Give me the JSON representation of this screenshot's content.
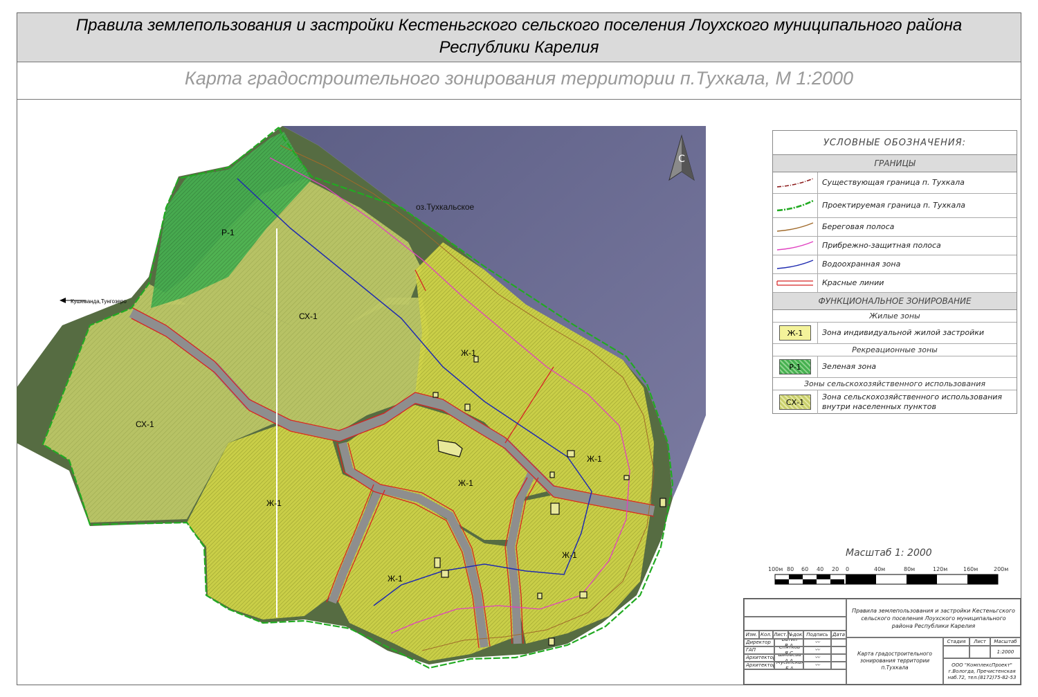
{
  "header": {
    "title_line1": "Правила землепользования и застройки Кестеньгского сельского поселения Лоухского муниципального района",
    "title_line2": "Республики Карелия",
    "map_title": "Карта градостроительного зонирования территории п.Тухкала,  М 1:2000"
  },
  "map": {
    "north_letter": "С",
    "lake_label": "оз.Тухкальское",
    "road_direction_label": "Кушеванда,Тунгозеро",
    "zone_labels": [
      {
        "id": "r1",
        "text": "Р-1"
      },
      {
        "id": "sx1a",
        "text": "СХ-1"
      },
      {
        "id": "sx1b",
        "text": "СХ-1"
      },
      {
        "id": "zh1a",
        "text": "Ж-1"
      },
      {
        "id": "zh1b",
        "text": "Ж-1"
      },
      {
        "id": "zh1c",
        "text": "Ж-1"
      },
      {
        "id": "zh1d",
        "text": "Ж-1"
      },
      {
        "id": "zh1e",
        "text": "Ж-1"
      },
      {
        "id": "zh1f",
        "text": "Ж-1"
      }
    ],
    "colors": {
      "water": "#6f6f90",
      "forest": "#4f6a3c",
      "zh1": "#d6d84a",
      "r1": "#3fae4f",
      "sx1": "#bcc76a",
      "red_line": "#d62424",
      "water_protect": "#1f2bb0",
      "coastal_protect": "#e040c0",
      "shoreline": "#a06a2a",
      "proj_border": "#22aa22",
      "exist_border": "#8b1a1a",
      "road": "#9a9a9a"
    }
  },
  "legend": {
    "title": "УСЛОВНЫЕ ОБОЗНАЧЕНИЯ:",
    "borders_header": "ГРАНИЦЫ",
    "borders": [
      {
        "symbol": "exist-border",
        "label": "Существующая граница п. Тухкала"
      },
      {
        "symbol": "proj-border",
        "label": "Проектируемая граница п. Тухкала"
      },
      {
        "symbol": "shoreline",
        "label": "Береговая полоса"
      },
      {
        "symbol": "coastal",
        "label": "Прибрежно-защитная полоса"
      },
      {
        "symbol": "water-protect",
        "label": "Водоохранная зона"
      },
      {
        "symbol": "red-lines",
        "label": "Красные линии"
      }
    ],
    "zoning_header": "ФУНКЦИОНАЛЬНОЕ ЗОНИРОВАНИЕ",
    "residential_header": "Жилые зоны",
    "residential_code": "Ж-1",
    "residential_label": "Зона индивидуальной жилой застройки",
    "recreation_header": "Рекреационные зоны",
    "recreation_code": "Р-1",
    "recreation_label": "Зеленая зона",
    "agri_header": "Зоны сельскохозяйственного использования",
    "agri_code": "СХ-1",
    "agri_label": "Зона сельскохозяйственного использования внутри населенных пунктов"
  },
  "scale": {
    "title": "Масштаб 1: 2000",
    "labels": [
      "100м",
      "80",
      "60",
      "40",
      "20",
      "0",
      "40м",
      "80м",
      "120м",
      "160м",
      "200м"
    ]
  },
  "stamp": {
    "project": "Правила землепользования и застройки Кестеньгского сельского поселения Лоухского муниципального района Республики Карелия",
    "headers": [
      "Изм.",
      "Кол.",
      "Лист.",
      "№док.",
      "Подпись",
      "Дата"
    ],
    "people": [
      {
        "role": "Директор",
        "name": "Батин В.А."
      },
      {
        "role": "ГАП",
        "name": "Снятков Я.С."
      },
      {
        "role": "Архитектор",
        "name": "Шибаева А.А."
      },
      {
        "role": "Архитектор",
        "name": "Мусинская Е.А."
      }
    ],
    "stage_h": "Стадия",
    "sheet_h": "Лист",
    "scale_h": "Масштаб",
    "scale_v": "1:2000",
    "drawing_name": "Карта градостроительного зонирования территории п.Тухкала",
    "org": "ООО \"КомплексПроект\" г.Вологда, Пречистенская наб.72, тел.(8172)75-82-53"
  }
}
